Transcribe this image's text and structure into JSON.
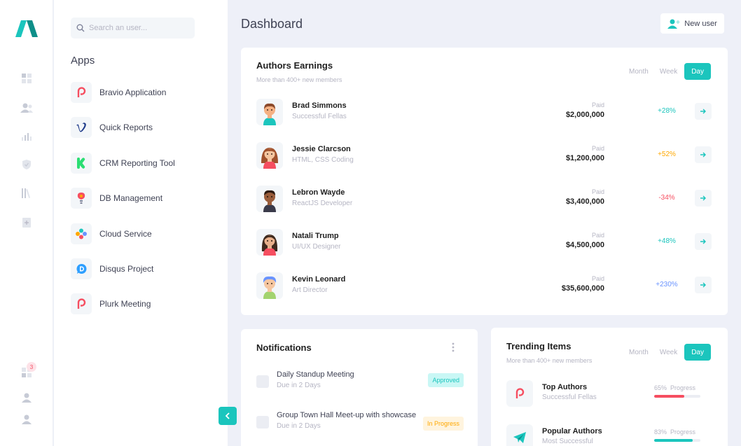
{
  "colors": {
    "accent": "#1bc5bd",
    "danger": "#f64e60",
    "warning": "#ffa800",
    "info": "#6993ff"
  },
  "sidebar": {
    "icons": [
      "dashboard-icon",
      "users-icon",
      "chart-icon",
      "shield-icon",
      "library-icon",
      "add-file-icon"
    ],
    "bottom_badge": "3"
  },
  "apps_panel": {
    "search_placeholder": "Search an user...",
    "title": "Apps",
    "items": [
      {
        "label": "Bravio Application",
        "icon": "bravio-icon"
      },
      {
        "label": "Quick Reports",
        "icon": "vimeo-icon"
      },
      {
        "label": "CRM Reporting Tool",
        "icon": "kickstarter-icon"
      },
      {
        "label": "DB Management",
        "icon": "db-icon"
      },
      {
        "label": "Cloud Service",
        "icon": "cloud-icon"
      },
      {
        "label": "Disqus Project",
        "icon": "disqus-icon"
      },
      {
        "label": "Plurk Meeting",
        "icon": "plurk-icon"
      }
    ]
  },
  "header": {
    "title": "Dashboard",
    "new_user_label": "New user"
  },
  "authors": {
    "title": "Authors Earnings",
    "subtitle": "More than 400+ new members",
    "tabs": [
      "Month",
      "Week",
      "Day"
    ],
    "active_tab": "Day",
    "rows": [
      {
        "name": "Brad Simmons",
        "role": "Successful Fellas",
        "paid_label": "Paid",
        "amount": "$2,000,000",
        "change": "+28%",
        "change_color": "#1bc5bd"
      },
      {
        "name": "Jessie Clarcson",
        "role": "HTML, CSS Coding",
        "paid_label": "Paid",
        "amount": "$1,200,000",
        "change": "+52%",
        "change_color": "#ffa800"
      },
      {
        "name": "Lebron Wayde",
        "role": "ReactJS Developer",
        "paid_label": "Paid",
        "amount": "$3,400,000",
        "change": "-34%",
        "change_color": "#f64e60"
      },
      {
        "name": "Natali Trump",
        "role": "UI/UX Designer",
        "paid_label": "Paid",
        "amount": "$4,500,000",
        "change": "+48%",
        "change_color": "#1bc5bd"
      },
      {
        "name": "Kevin Leonard",
        "role": "Art Director",
        "paid_label": "Paid",
        "amount": "$35,600,000",
        "change": "+230%",
        "change_color": "#6993ff"
      }
    ]
  },
  "notifications": {
    "title": "Notifications",
    "items": [
      {
        "title": "Daily Standup Meeting",
        "due": "Due in 2 Days",
        "status": "Approved",
        "status_bg": "#c9f7f5",
        "status_fg": "#1bc5bd"
      },
      {
        "title": "Group Town Hall Meet-up with showcase",
        "due": "Due in 2 Days",
        "status": "In Progress",
        "status_bg": "#fff4de",
        "status_fg": "#ffa800"
      }
    ]
  },
  "trending": {
    "title": "Trending Items",
    "subtitle": "More than 400+ new members",
    "tabs": [
      "Month",
      "Week",
      "Day"
    ],
    "active_tab": "Day",
    "items": [
      {
        "name": "Top Authors",
        "sub": "Successful Fellas",
        "percent_label": "65%",
        "progress_label": "Progress",
        "progress": 0.65,
        "color": "#f64e60",
        "icon": "bravio-icon"
      },
      {
        "name": "Popular Authors",
        "sub": "Most Successful",
        "percent_label": "83%",
        "progress_label": "Progress",
        "progress": 0.83,
        "color": "#1bc5bd",
        "icon": "telegram-icon"
      }
    ]
  }
}
